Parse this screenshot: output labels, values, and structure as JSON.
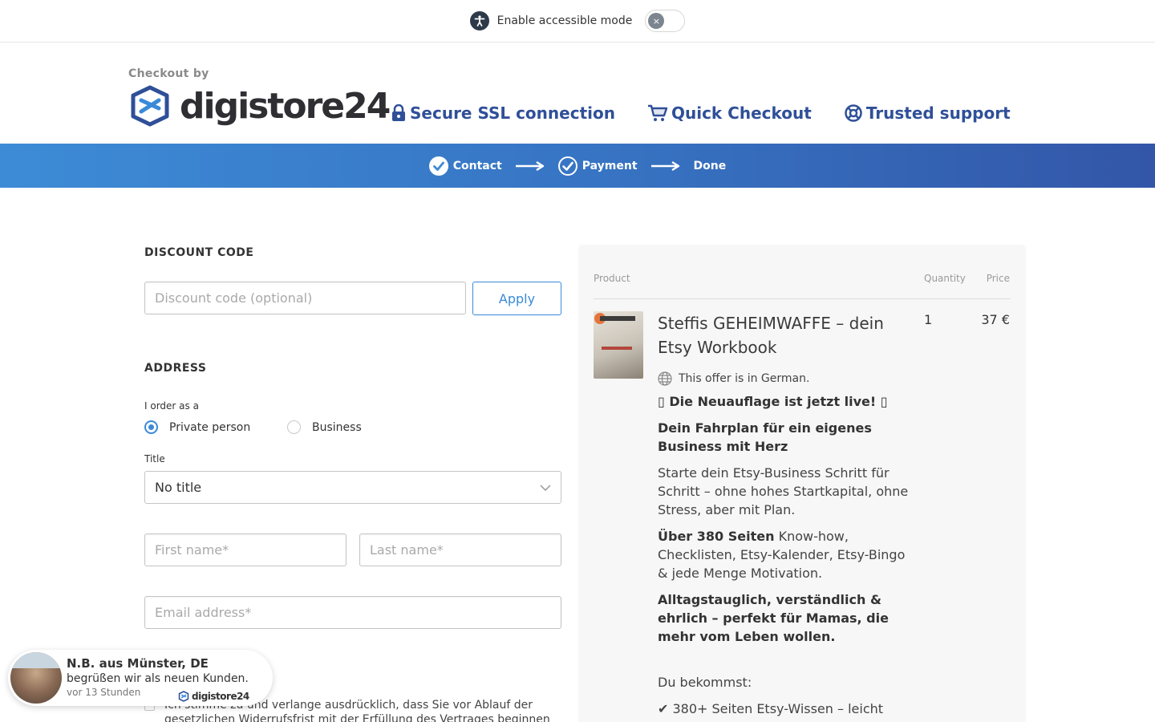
{
  "a11y": {
    "label": "Enable accessible mode",
    "toggle_symbol": "×"
  },
  "header": {
    "checkout_by": "Checkout by",
    "brand": "digistore24",
    "features": [
      {
        "label": "Secure SSL connection",
        "icon": "lock-icon"
      },
      {
        "label": "Quick Checkout",
        "icon": "cart-icon"
      },
      {
        "label": "Trusted support",
        "icon": "lifebuoy-icon"
      }
    ]
  },
  "steps": [
    {
      "label": "Contact",
      "done": true
    },
    {
      "label": "Payment",
      "done": true
    },
    {
      "label": "Done",
      "done": false
    }
  ],
  "discount": {
    "title": "DISCOUNT CODE",
    "placeholder": "Discount code (optional)",
    "apply_label": "Apply"
  },
  "address": {
    "title": "ADDRESS",
    "order_as_label": "I order as a",
    "options": [
      {
        "label": "Private person",
        "checked": true
      },
      {
        "label": "Business",
        "checked": false
      }
    ],
    "title_label": "Title",
    "title_value": "No title",
    "first_name_placeholder": "First name*",
    "last_name_placeholder": "Last name*",
    "email_placeholder": "Email address*"
  },
  "consent": {
    "text": "Ich stimme zu und verlange ausdrücklich, dass Sie vor Ablauf der gesetzlichen Widerrufsfrist mit der Erfüllung des Vertrages beginnen"
  },
  "order": {
    "headers": {
      "product": "Product",
      "quantity": "Quantity",
      "price": "Price"
    },
    "product_name": "Steffis GEHEIMWAFFE – dein Etsy Workbook",
    "quantity": "1",
    "price": "37 €",
    "language_note": "This offer is in German.",
    "desc_headline": "▯ Die Neuauflage ist jetzt live! ▯",
    "desc_subhead": "Dein Fahrplan für ein eigenes Business mit Herz",
    "desc_p1": "Starte dein Etsy-Business Schritt für Schritt – ohne hohes Startkapital, ohne Stress, aber mit Plan.",
    "desc_p2_bold": "Über 380 Seiten",
    "desc_p2_rest": " Know-how, Checklisten, Etsy-Kalender, Etsy-Bingo & jede Menge Motivation.",
    "desc_p3": "Alltagstauglich, verständlich & ehrlich – perfekt für Mamas, die mehr vom Leben wollen.",
    "desc_you_get": "Du bekommst:",
    "desc_bullet1": "✔ 380+ Seiten Etsy-Wissen – leicht"
  },
  "toast": {
    "title": "N.B. aus Münster, DE",
    "subtitle": "begrüßen wir als neuen Kunden.",
    "time": "vor 13 Stunden",
    "brand": "digistore24"
  },
  "colors": {
    "accent": "#3a8ad8",
    "brand_navy": "#2f4f98",
    "band_start": "#3d8bd6",
    "band_end": "#3356a8"
  }
}
